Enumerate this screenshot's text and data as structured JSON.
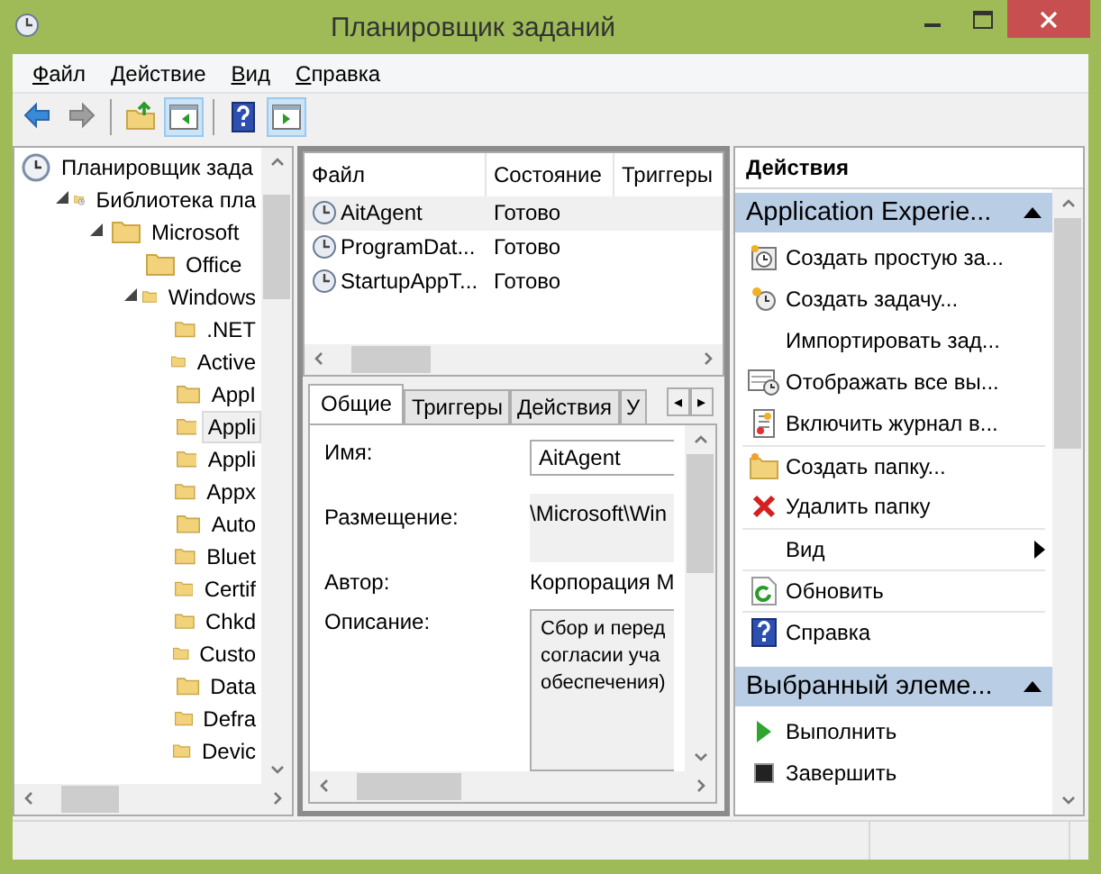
{
  "window": {
    "title": "Планировщик заданий"
  },
  "menu": [
    {
      "label": "Файл"
    },
    {
      "label": "Действие"
    },
    {
      "label": "Вид"
    },
    {
      "label": "Справка"
    }
  ],
  "toolbar": [
    [
      {
        "kind": "back",
        "disabled": false,
        "pressed": false
      },
      {
        "kind": "forward",
        "disabled": true,
        "pressed": false
      }
    ],
    [
      {
        "kind": "folder-up",
        "disabled": false,
        "pressed": false
      },
      {
        "kind": "tree-pane",
        "disabled": false,
        "pressed": true
      }
    ],
    [
      {
        "kind": "help",
        "disabled": false,
        "pressed": false
      },
      {
        "kind": "action-pane",
        "disabled": false,
        "pressed": true
      }
    ]
  ],
  "tree": [
    {
      "label": "Планировщик зада",
      "kind": "scheduler",
      "selected": false,
      "children": [
        {
          "label": "Библиотека пла",
          "kind": "library",
          "expanded": true,
          "selected": false,
          "children": [
            {
              "label": "Microsoft",
              "kind": "folder",
              "expanded": true,
              "selected": false,
              "children": [
                {
                  "label": "Office",
                  "kind": "folder",
                  "expanded": false,
                  "selected": false
                },
                {
                  "label": "Windows",
                  "kind": "folder",
                  "expanded": true,
                  "selected": false,
                  "children": [
                    {
                      "label": ".NET",
                      "kind": "folder",
                      "expanded": false,
                      "selected": false
                    },
                    {
                      "label": "Active",
                      "kind": "folder",
                      "expanded": false,
                      "selected": false
                    },
                    {
                      "label": "AppI",
                      "kind": "folder",
                      "expanded": false,
                      "selected": false
                    },
                    {
                      "label": "Appli",
                      "kind": "folder",
                      "expanded": false,
                      "selected": true
                    },
                    {
                      "label": "Appli",
                      "kind": "folder",
                      "expanded": false,
                      "selected": false
                    },
                    {
                      "label": "Appx",
                      "kind": "folder",
                      "expanded": false,
                      "selected": false
                    },
                    {
                      "label": "Auto",
                      "kind": "folder",
                      "expanded": false,
                      "selected": false
                    },
                    {
                      "label": "Bluet",
                      "kind": "folder",
                      "expanded": false,
                      "selected": false
                    },
                    {
                      "label": "Certif",
                      "kind": "folder",
                      "expanded": false,
                      "selected": false
                    },
                    {
                      "label": "Chkd",
                      "kind": "folder",
                      "expanded": false,
                      "selected": false
                    },
                    {
                      "label": "Custo",
                      "kind": "folder",
                      "expanded": false,
                      "selected": false
                    },
                    {
                      "label": "Data",
                      "kind": "folder",
                      "expanded": false,
                      "selected": false
                    },
                    {
                      "label": "Defra",
                      "kind": "folder",
                      "expanded": false,
                      "selected": false
                    },
                    {
                      "label": "Devic",
                      "kind": "folder",
                      "expanded": false,
                      "selected": false
                    }
                  ]
                }
              ]
            }
          ]
        }
      ]
    }
  ],
  "task_list": {
    "columns": [
      "Файл",
      "Состояние",
      "Триггеры"
    ],
    "rows": [
      {
        "name": "AitAgent",
        "status": "Готово",
        "selected": true
      },
      {
        "name": "ProgramDat...",
        "status": "Готово",
        "selected": false
      },
      {
        "name": "StartupAppT...",
        "status": "Готово",
        "selected": false
      }
    ]
  },
  "details": {
    "tabs": [
      {
        "label": "Общие",
        "selected": true
      },
      {
        "label": "Триггеры",
        "selected": false
      },
      {
        "label": "Действия",
        "selected": false
      },
      {
        "label": "У",
        "selected": false
      }
    ],
    "tab_scroll": [
      "◂",
      "▸"
    ],
    "fields": [
      {
        "label": "Имя:",
        "kind": "input",
        "value": "AitAgent"
      },
      {
        "label": "Размещение:",
        "kind": "readonly",
        "value": "\\Microsoft\\Win"
      },
      {
        "label": "Автор:",
        "kind": "text",
        "value": "Корпорация M"
      },
      {
        "label": "Описание:",
        "kind": "multiline",
        "value": "Сбор и перед\nсогласии уча\nобеспечения)"
      }
    ]
  },
  "actions": {
    "title": "Действия",
    "groups": [
      {
        "title": "Application Experie...",
        "expanded": true,
        "items": [
          {
            "label": "Создать простую за...",
            "kind": "basic-task",
            "submenu": false,
            "separated": false
          },
          {
            "label": "Создать задачу...",
            "kind": "task",
            "submenu": false,
            "separated": false
          },
          {
            "label": "Импортировать зад...",
            "kind": "plain",
            "submenu": false,
            "separated": false
          },
          {
            "label": "Отображать все вы...",
            "kind": "show-all",
            "submenu": false,
            "separated": false
          },
          {
            "label": "Включить журнал в...",
            "kind": "log",
            "submenu": false,
            "separated": false
          },
          {
            "label": "Создать папку...",
            "kind": "new-folder",
            "submenu": false,
            "separated": true
          },
          {
            "label": "Удалить папку",
            "kind": "delete",
            "submenu": false,
            "separated": false
          },
          {
            "label": "Вид",
            "kind": "plain",
            "submenu": true,
            "separated": true
          },
          {
            "label": "Обновить",
            "kind": "refresh",
            "submenu": false,
            "separated": true
          },
          {
            "label": "Справка",
            "kind": "help",
            "submenu": false,
            "separated": true
          }
        ]
      },
      {
        "title": "Выбранный элеме...",
        "expanded": true,
        "items": [
          {
            "label": "Выполнить",
            "kind": "run",
            "submenu": false,
            "separated": false
          },
          {
            "label": "Завершить",
            "kind": "stop",
            "submenu": false,
            "separated": false
          }
        ]
      }
    ]
  }
}
